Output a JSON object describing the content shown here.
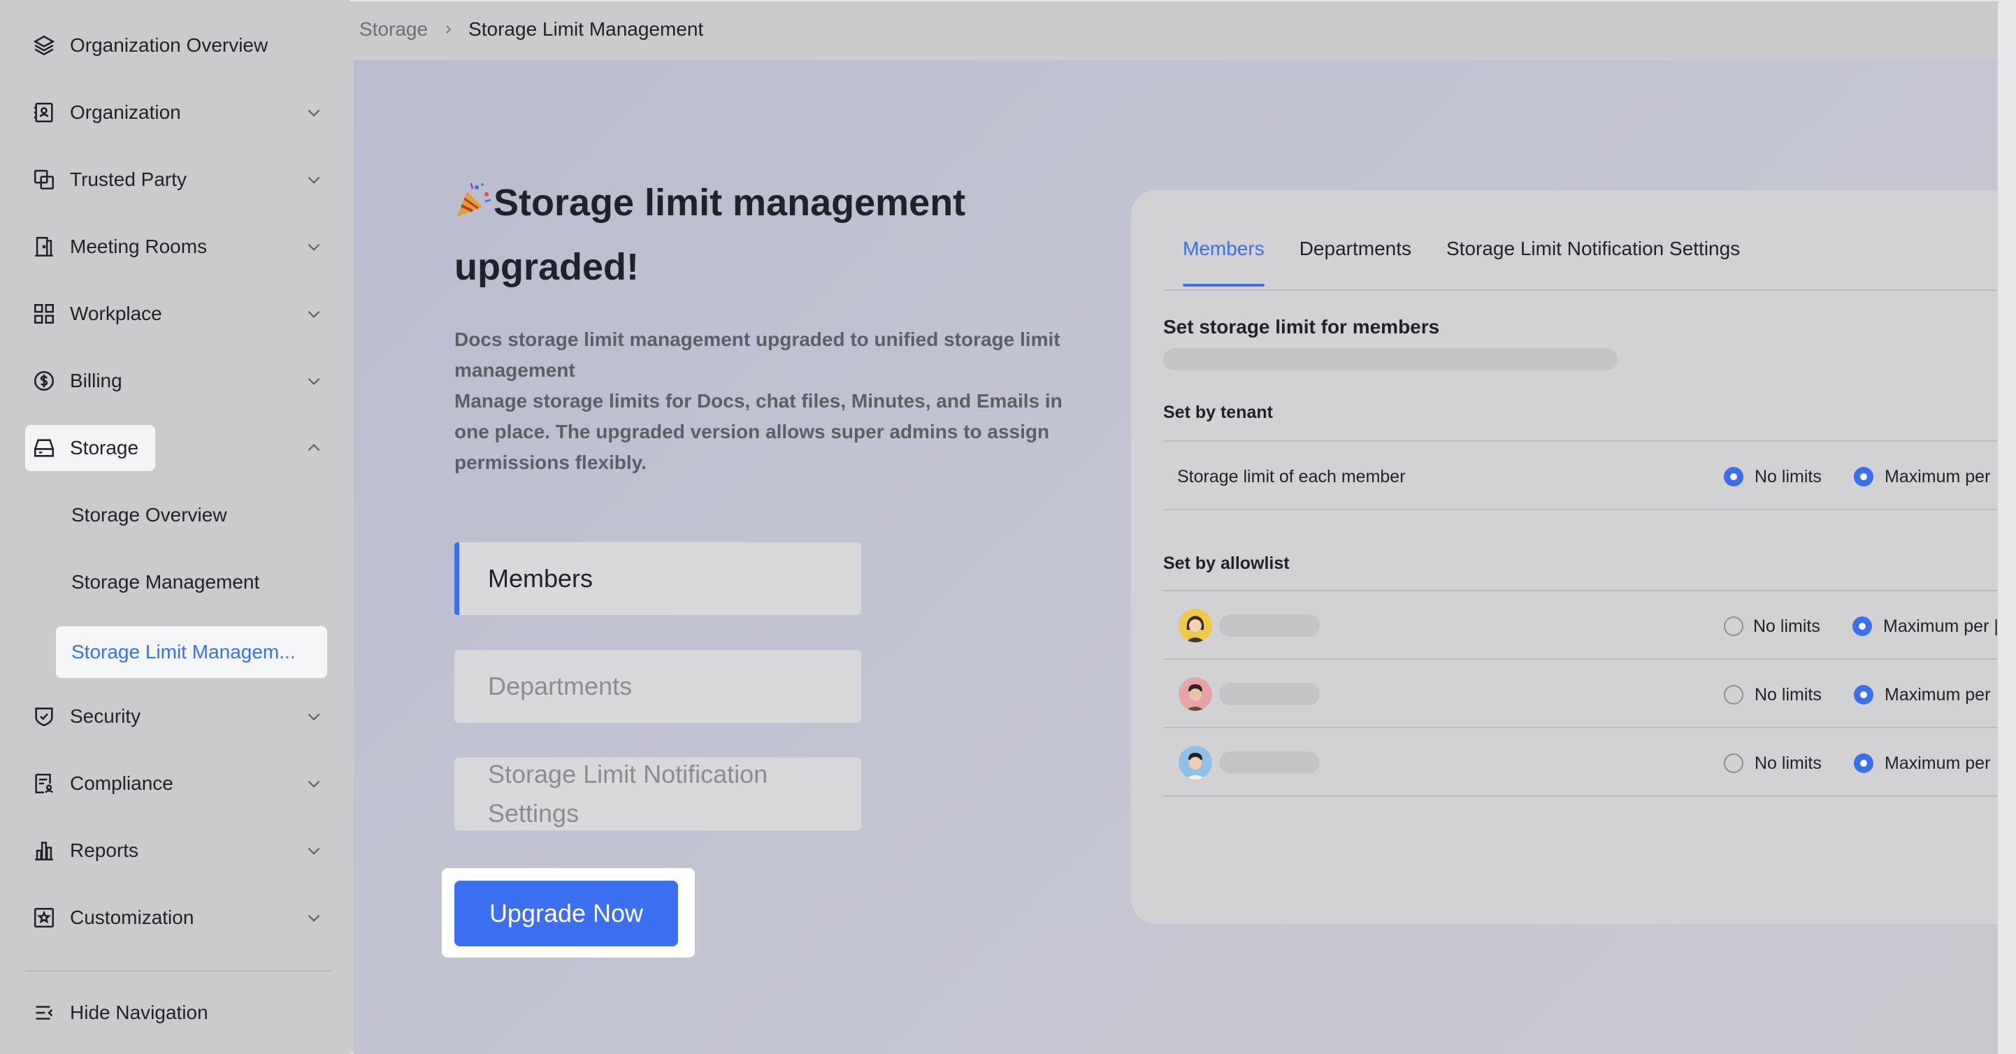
{
  "sidebar": {
    "items": [
      {
        "label": "Organization Overview",
        "icon": "layers-icon",
        "chevron": false
      },
      {
        "label": "Organization",
        "icon": "contact-book-icon",
        "chevron": true
      },
      {
        "label": "Trusted Party",
        "icon": "link-squares-icon",
        "chevron": true
      },
      {
        "label": "Meeting Rooms",
        "icon": "door-icon",
        "chevron": true
      },
      {
        "label": "Workplace",
        "icon": "grid-icon",
        "chevron": true
      },
      {
        "label": "Billing",
        "icon": "dollar-circle-icon",
        "chevron": true
      },
      {
        "label": "Storage",
        "icon": "drive-icon",
        "chevron": "up"
      },
      {
        "label": "Security",
        "icon": "shield-check-icon",
        "chevron": true
      },
      {
        "label": "Compliance",
        "icon": "document-person-icon",
        "chevron": true
      },
      {
        "label": "Reports",
        "icon": "bar-chart-icon",
        "chevron": true
      },
      {
        "label": "Customization",
        "icon": "star-frame-icon",
        "chevron": true
      }
    ],
    "storage_sub": [
      {
        "label": "Storage Overview"
      },
      {
        "label": "Storage Management"
      },
      {
        "label": "Storage Limit Managem..."
      }
    ],
    "hide_navigation": "Hide Navigation"
  },
  "breadcrumb": {
    "parent": "Storage",
    "current": "Storage Limit Management"
  },
  "promo": {
    "headline_line1": "Storage limit management",
    "headline_line2": "upgraded!",
    "desc_line1": "Docs storage limit management upgraded to unified storage limit",
    "desc_line2": "management",
    "desc_line3": "Manage storage limits for Docs, chat files, Minutes, and Emails in",
    "desc_line4": "one place. The upgraded version allows super admins to assign",
    "desc_line5": "permissions flexibly.",
    "feature_tabs": [
      "Members",
      "Departments",
      "Storage Limit Notification",
      "Settings"
    ],
    "upgrade_button": "Upgrade Now"
  },
  "preview": {
    "tabs": [
      "Members",
      "Departments",
      "Storage Limit Notification Settings"
    ],
    "title": "Set storage limit for members",
    "set_by_tenant": "Set by tenant",
    "tenant_row": "Storage limit of each member",
    "set_by_allowlist": "Set by allowlist",
    "no_limits": "No limits",
    "maximum_per": "Maximum per",
    "maximum_per_clipped": "Maximum per |"
  },
  "colors": {
    "accent": "#3a6ff0",
    "upgrade_button": "#3c6ef0"
  }
}
